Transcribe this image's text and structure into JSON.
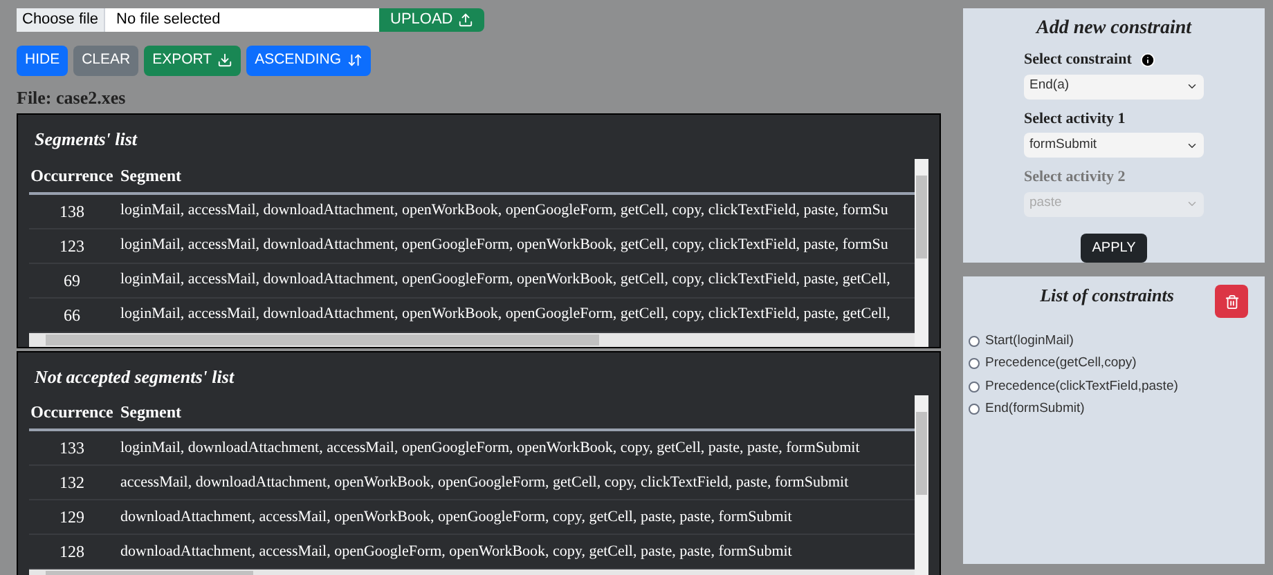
{
  "file_input": {
    "button": "Choose file",
    "value": "No file selected",
    "upload": "UPLOAD"
  },
  "toolbar": [
    {
      "label": "HIDE",
      "kind": "blue"
    },
    {
      "label": "CLEAR",
      "kind": "gray"
    },
    {
      "label": "EXPORT",
      "kind": "green"
    },
    {
      "label": "ASCENDING",
      "kind": "blue"
    }
  ],
  "file_label": "File: case2.xes",
  "tables": [
    {
      "title": "Segments' list",
      "columns": [
        "Occurrence",
        "Segment"
      ],
      "rows": [
        [
          "138",
          "loginMail, accessMail, downloadAttachment, openWorkBook, openGoogleForm, getCell, copy, clickTextField, paste, formSu"
        ],
        [
          "123",
          "loginMail, accessMail, downloadAttachment, openGoogleForm, openWorkBook, getCell, copy, clickTextField, paste, formSu"
        ],
        [
          "69",
          "loginMail, accessMail, downloadAttachment, openGoogleForm, openWorkBook, getCell, copy, clickTextField, paste, getCell,"
        ],
        [
          "66",
          "loginMail, accessMail, downloadAttachment, openWorkBook, openGoogleForm, getCell, copy, clickTextField, paste, getCell,"
        ]
      ]
    },
    {
      "title": "Not accepted segments' list",
      "columns": [
        "Occurrence",
        "Segment"
      ],
      "rows": [
        [
          "133",
          "loginMail, downloadAttachment, accessMail, openGoogleForm, openWorkBook, copy, getCell, paste, paste, formSubmit"
        ],
        [
          "132",
          "accessMail, downloadAttachment, openWorkBook, openGoogleForm, getCell, copy, clickTextField, paste, formSubmit"
        ],
        [
          "129",
          "downloadAttachment, accessMail, openWorkBook, openGoogleForm, copy, getCell, paste, paste, formSubmit"
        ],
        [
          "128",
          "downloadAttachment, accessMail, openGoogleForm, openWorkBook, copy, getCell, paste, paste, formSubmit"
        ]
      ]
    }
  ],
  "add_constraint": {
    "title": "Add new constraint",
    "fields": [
      {
        "label": "Select constraint",
        "value": "End(a)",
        "disabled": false,
        "info": true
      },
      {
        "label": "Select activity 1",
        "value": "formSubmit",
        "disabled": false,
        "info": false
      },
      {
        "label": "Select activity 2",
        "value": "paste",
        "disabled": true,
        "info": false
      }
    ],
    "apply": "APPLY"
  },
  "constraints": {
    "title": "List of constraints",
    "items": [
      {
        "label": "Start(loginMail)",
        "selected": false
      },
      {
        "label": "Precedence(getCell,copy)",
        "selected": false
      },
      {
        "label": "Precedence(clickTextField,paste)",
        "selected": false
      },
      {
        "label": "End(formSubmit)",
        "selected": false
      }
    ]
  }
}
